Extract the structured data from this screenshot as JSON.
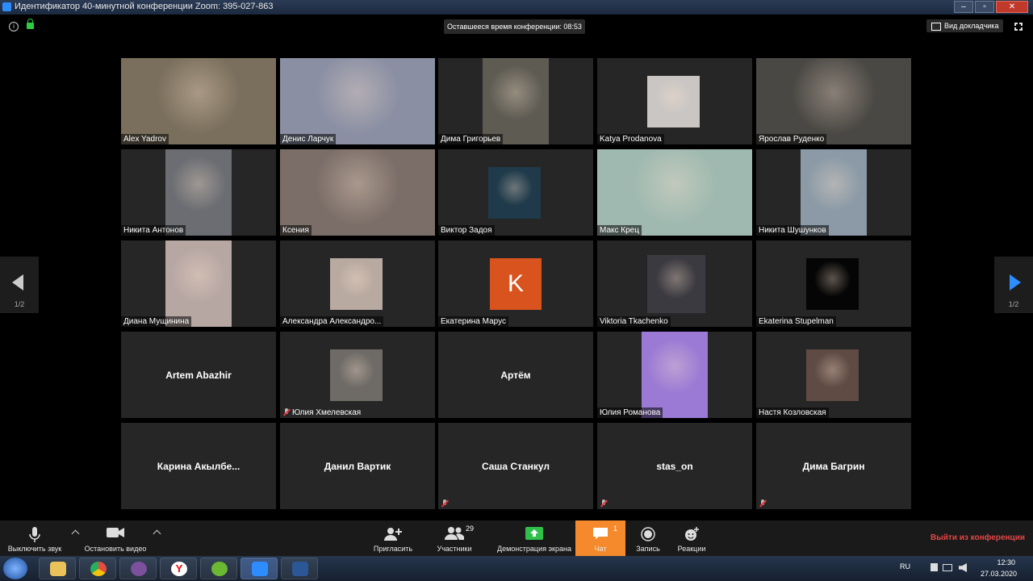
{
  "window": {
    "title": "Идентификатор 40-минутной конференции Zoom: 395-027-863",
    "buttons": [
      "–",
      "▫",
      "✕"
    ]
  },
  "topbar": {
    "timer": "Оставшееся время конференции: 08:53",
    "speaker_view": "Вид докладчика"
  },
  "pagination": {
    "left": "1/2",
    "right": "1/2"
  },
  "participants": [
    {
      "name": "Alex Yadrov",
      "type": "video",
      "tone": "#7a6f5c",
      "active": true
    },
    {
      "name": "Денис Ларчук",
      "type": "video",
      "tone": "#8a8fa3"
    },
    {
      "name": "Дима Григорьев",
      "type": "video",
      "tone": "#5d5b52"
    },
    {
      "name": "Katya Prodanova",
      "type": "video",
      "tone": "#c9c6c3"
    },
    {
      "name": "Ярослав Руденко",
      "type": "video",
      "tone": "#4a4844"
    },
    {
      "name": "Никита Антонов",
      "type": "video",
      "tone": "#6b6d72"
    },
    {
      "name": "Ксения",
      "type": "video",
      "tone": "#7b6e68"
    },
    {
      "name": "Виктор Задоя",
      "type": "video",
      "tone": "#1f3a4a"
    },
    {
      "name": "Макс Крец",
      "type": "video",
      "tone": "#9fb9b0"
    },
    {
      "name": "Никита Шушунков",
      "type": "video",
      "tone": "#8b9aa6"
    },
    {
      "name": "Диана Мущинина",
      "type": "video",
      "tone": "#b7a7a3"
    },
    {
      "name": "Александра Александро...",
      "type": "video",
      "tone": "#b9aaa1"
    },
    {
      "name": "Екатерина Марус",
      "type": "initial",
      "initial": "K"
    },
    {
      "name": "Viktoria Tkachenko",
      "type": "video",
      "tone": "#3b3a40"
    },
    {
      "name": "Ekaterina Stupelman",
      "type": "video",
      "tone": "#050505"
    },
    {
      "name": "Artem Abazhir",
      "type": "name"
    },
    {
      "name": "Юлия Хмелевская",
      "type": "video",
      "tone": "#6e6a66",
      "muted": true
    },
    {
      "name": "Артём",
      "type": "name"
    },
    {
      "name": "Юлия Романова",
      "type": "video",
      "tone": "#9a7ad4"
    },
    {
      "name": "Настя Козловская",
      "type": "video",
      "tone": "#5f4a44"
    },
    {
      "name": "Карина  Акылбе...",
      "type": "name"
    },
    {
      "name": "Данил Вартик",
      "type": "name"
    },
    {
      "name": "Саша Станкул",
      "type": "name",
      "muted": true
    },
    {
      "name": "stas_on",
      "type": "name",
      "muted": true
    },
    {
      "name": "Дима Багрин",
      "type": "name",
      "muted": true
    }
  ],
  "toolbar": {
    "mute": "Выключить звук",
    "stop_video": "Остановить видео",
    "invite": "Пригласить",
    "participants": "Участники",
    "participants_count": "29",
    "share": "Демонстрация экрана",
    "chat": "Чат",
    "chat_count": "1",
    "record": "Запись",
    "reactions": "Реакции",
    "leave": "Выйти из конференции"
  },
  "taskbar": {
    "apps": [
      "folder-icon",
      "chrome-icon",
      "viber-icon",
      "yandex-icon",
      "utorrent-icon",
      "zoom-icon",
      "word-icon"
    ],
    "lang": "RU",
    "time": "12:30",
    "date": "27.03.2020"
  },
  "colors": {
    "accent": "#2d8cff",
    "chat": "#f58a2c",
    "leave": "#e54545",
    "active_border": "#e7e26a",
    "initial_bg": "#d9531e"
  }
}
